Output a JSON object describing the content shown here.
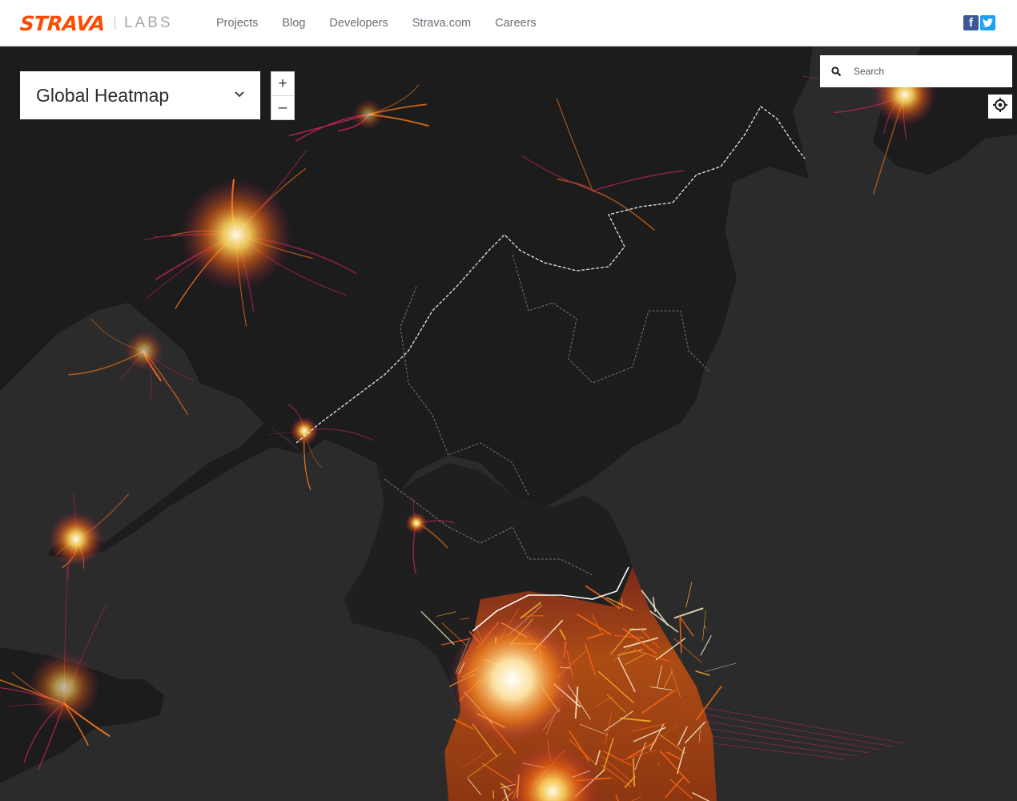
{
  "header": {
    "brand": "STRAVA",
    "brand_sub": "LABS",
    "nav": [
      "Projects",
      "Blog",
      "Developers",
      "Strava.com",
      "Careers"
    ],
    "social": [
      {
        "name": "facebook",
        "glyph": "f",
        "color": "#3b5998"
      },
      {
        "name": "twitter",
        "glyph": "t",
        "color": "#1da1f2"
      }
    ]
  },
  "map_controls": {
    "heatmap_select": "Global Heatmap",
    "zoom_in": "+",
    "zoom_out": "–",
    "search_placeholder": "Search",
    "icons": [
      "search-icon",
      "chevron-down-icon",
      "locate-icon"
    ]
  },
  "colors": {
    "brand": "#fc4c02",
    "water": "#2b2b2b",
    "land": "#1d1d1d",
    "heat_low": "#b8235a",
    "heat_mid": "#ff7a1a",
    "heat_high": "#ffe9b0"
  }
}
